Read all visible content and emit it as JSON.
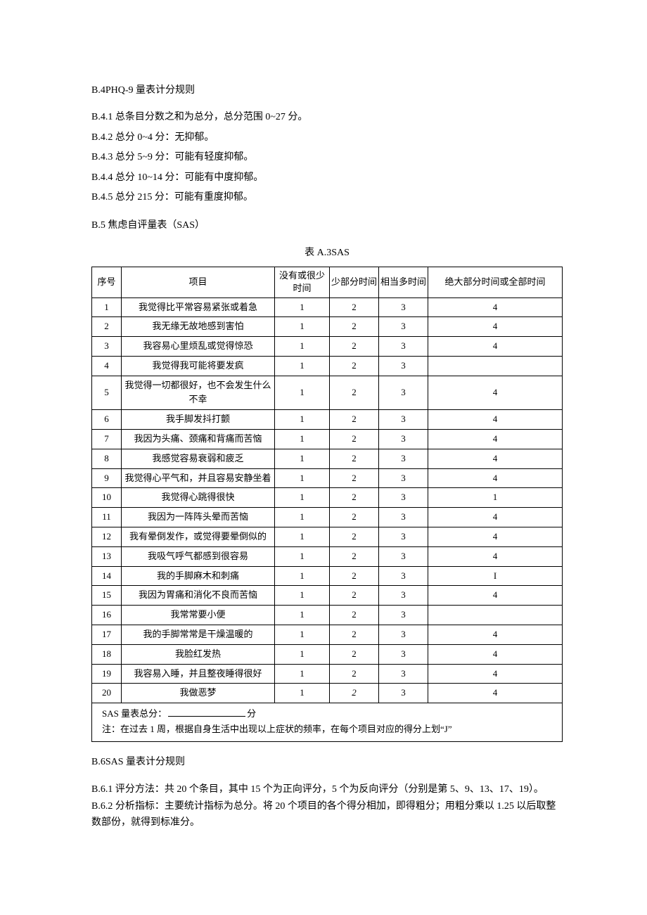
{
  "section_b4": {
    "heading": "B.4PHQ-9 量表计分规则",
    "lines": [
      "B.4.1 总条目分数之和为总分，总分范围 0~27 分。",
      "B.4.2 总分 0~4 分：无抑郁。",
      "B.4.3 总分 5~9 分：可能有轻度抑郁。",
      "B.4.4 总分 10~14 分：可能有中度抑郁。",
      "B.4.5 总分 215 分：可能有重度抑郁。"
    ]
  },
  "section_b5": {
    "heading": "B.5 焦虑自评量表（SAS）",
    "table_caption": "表 A.3SAS",
    "headers": {
      "seq": "序号",
      "item": "项目",
      "freq1": "没有或很少时间",
      "freq2": "少部分时间",
      "freq3": "相当多时间",
      "freq4": "绝大部分时间或全部时间"
    },
    "rows": [
      {
        "seq": "1",
        "item": "我觉得比平常容易紧张或着急",
        "c1": "1",
        "c2": "2",
        "c3": "3",
        "c4": "4"
      },
      {
        "seq": "2",
        "item": "我无缘无故地感到害怕",
        "c1": "1",
        "c2": "2",
        "c3": "3",
        "c4": "4"
      },
      {
        "seq": "3",
        "item": "我容易心里烦乱或觉得惊恐",
        "c1": "1",
        "c2": "2",
        "c3": "3",
        "c4": "4"
      },
      {
        "seq": "4",
        "item": "我觉得我可能将要发疯",
        "c1": "1",
        "c2": "2",
        "c3": "3",
        "c4": ""
      },
      {
        "seq": "5",
        "item": "我觉得一切都很好，也不会发生什么不幸",
        "c1": "1",
        "c2": "2",
        "c3": "3",
        "c4": "4"
      },
      {
        "seq": "6",
        "item": "我手脚发抖打颤",
        "c1": "1",
        "c2": "2",
        "c3": "3",
        "c4": "4"
      },
      {
        "seq": "7",
        "item": "我因为头痛、颈痛和背痛而苦恼",
        "c1": "1",
        "c2": "2",
        "c3": "3",
        "c4": "4"
      },
      {
        "seq": "8",
        "item": "我感觉容易衰弱和疲乏",
        "c1": "1",
        "c2": "2",
        "c3": "3",
        "c4": "4"
      },
      {
        "seq": "9",
        "item": "我觉得心平气和，并且容易安静坐着",
        "c1": "1",
        "c2": "2",
        "c3": "3",
        "c4": "4"
      },
      {
        "seq": "10",
        "item": "我觉得心跳得很快",
        "c1": "1",
        "c2": "2",
        "c3": "3",
        "c4": "1"
      },
      {
        "seq": "11",
        "item": "我因为一阵阵头晕而苦恼",
        "c1": "1",
        "c2": "2",
        "c3": "3",
        "c4": "4"
      },
      {
        "seq": "12",
        "item": "我有晕倒发作，或觉得要晕倒似的",
        "c1": "1",
        "c2": "2",
        "c3": "3",
        "c4": "4"
      },
      {
        "seq": "13",
        "item": "我吸气呼气都感到很容易",
        "c1": "1",
        "c2": "2",
        "c3": "3",
        "c4": "4"
      },
      {
        "seq": "14",
        "item": "我的手脚麻木和刺痛",
        "c1": "1",
        "c2": "2",
        "c3": "3",
        "c4": "I"
      },
      {
        "seq": "15",
        "item": "我因为胃痛和消化不良而苦恼",
        "c1": "1",
        "c2": "2",
        "c3": "3",
        "c4": "4"
      },
      {
        "seq": "16",
        "item": "我常常要小便",
        "c1": "1",
        "c2": "2",
        "c3": "3",
        "c4": ""
      },
      {
        "seq": "17",
        "item": "我的手脚常常是干燥温暖的",
        "c1": "1",
        "c2": "2",
        "c3": "3",
        "c4": "4"
      },
      {
        "seq": "18",
        "item": "我脸红发热",
        "c1": "1",
        "c2": "2",
        "c3": "3",
        "c4": "4"
      },
      {
        "seq": "19",
        "item": "我容易入睡，并且整夜睡得很好",
        "c1": "1",
        "c2": "2",
        "c3": "3",
        "c4": "4"
      },
      {
        "seq": "20",
        "item": "我做恶梦",
        "c1": "1",
        "c2": "2",
        "c3": "3",
        "c4": "4",
        "italic_c2": true
      }
    ],
    "footer": {
      "total_label_prefix": "SAS 量表总分：",
      "total_label_suffix": "分",
      "note": "注：在过去 1 周，根据自身生活中出现以上症状的频率，在每个项目对应的得分上划“J”"
    }
  },
  "section_b6": {
    "heading": "B.6SAS 量表计分规则",
    "lines": [
      "B.6.1 评分方法：共 20 个条目，其中 15 个为正向评分，5 个为反向评分（分别是第 5、9、13、17、19）。",
      "B.6.2 分析指标：主要统计指标为总分。将 20 个项目的各个得分相加，即得粗分；用粗分乘以 1.25 以后取整数部份，就得到标准分。"
    ]
  }
}
